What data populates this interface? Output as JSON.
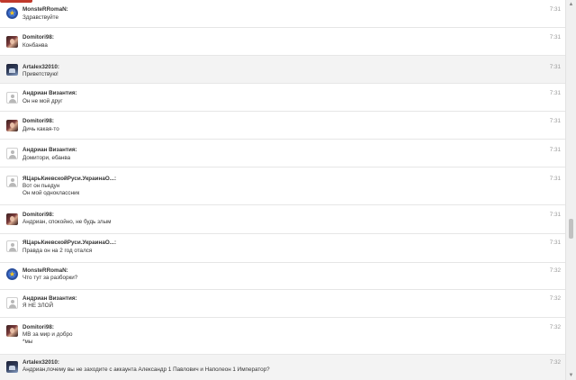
{
  "scrollbar": {
    "up_icon": "▲",
    "down_icon": "▼"
  },
  "messages": [
    {
      "author": "MonsteRRomaN:",
      "lines": [
        "Здравствуйте"
      ],
      "time": "7:31",
      "avatar": "blue-emblem"
    },
    {
      "author": "Domitori98:",
      "lines": [
        "Конбанва"
      ],
      "time": "7:31",
      "avatar": "photo"
    },
    {
      "author": "Artalex32010:",
      "lines": [
        "Приветствую!"
      ],
      "time": "7:31",
      "avatar": "dark-image"
    },
    {
      "author": "Андриан Византия:",
      "lines": [
        "Он не мой друг"
      ],
      "time": "7:31",
      "avatar": "default-user"
    },
    {
      "author": "Domitori98:",
      "lines": [
        "Дичь какая-то"
      ],
      "time": "7:31",
      "avatar": "photo"
    },
    {
      "author": "Андриан Византия:",
      "lines": [
        "Домитори, ебанва"
      ],
      "time": "7:31",
      "avatar": "default-user"
    },
    {
      "author": "ЯЦарьКиевскойРуси.УкраинаО...:",
      "lines": [
        "Вот он пьедун",
        "Он мой одноклассник"
      ],
      "time": "7:31",
      "avatar": "default-user"
    },
    {
      "author": "Domitori98:",
      "lines": [
        "Андриан, спокойно, не будь злым"
      ],
      "time": "7:31",
      "avatar": "photo"
    },
    {
      "author": "ЯЦарьКиевскойРуси.УкраинаО...:",
      "lines": [
        "Правда он на 2 год отался"
      ],
      "time": "7:31",
      "avatar": "default-user"
    },
    {
      "author": "MonsteRRomaN:",
      "lines": [
        "Что тут за разборки?"
      ],
      "time": "7:32",
      "avatar": "blue-emblem"
    },
    {
      "author": "Андриан Византия:",
      "lines": [
        "Я НЕ ЗЛОЙ"
      ],
      "time": "7:32",
      "avatar": "default-user"
    },
    {
      "author": "Domitori98:",
      "lines": [
        "МВ за мир и добро",
        "*мы"
      ],
      "time": "7:32",
      "avatar": "photo"
    },
    {
      "author": "Artalex32010:",
      "lines": [
        "Андриан,почему вы не заходите с аккаунта Александр 1 Павлович и Наполеон 1 Император?"
      ],
      "time": "7:32",
      "avatar": "dark-image"
    }
  ]
}
